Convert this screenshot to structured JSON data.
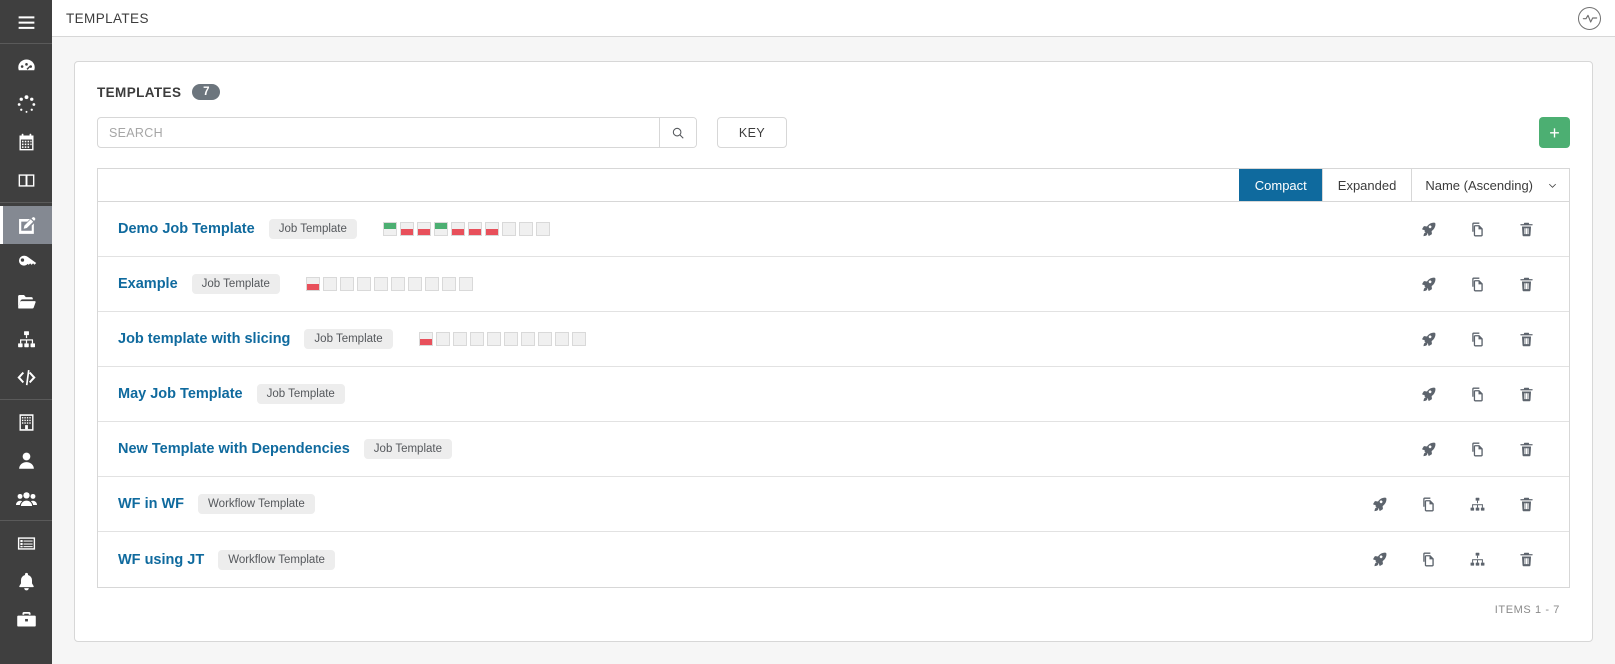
{
  "topbar": {
    "title": "TEMPLATES",
    "logo_icon": "ansible-logo-icon"
  },
  "sidebar": {
    "items": [
      {
        "icon": "hamburger-menu-icon",
        "name": "menu-toggle",
        "active": false
      },
      {
        "icon": "dashboard-gauge-icon",
        "name": "sidebar-item-dashboard",
        "active": false
      },
      {
        "icon": "jobs-spinner-icon",
        "name": "sidebar-item-jobs",
        "active": false
      },
      {
        "icon": "calendar-icon",
        "name": "sidebar-item-schedules",
        "active": false
      },
      {
        "icon": "columns-icon",
        "name": "sidebar-item-activity-stream",
        "active": false
      },
      {
        "icon": "edit-template-icon",
        "name": "sidebar-item-templates",
        "active": true
      },
      {
        "icon": "key-icon",
        "name": "sidebar-item-credentials",
        "active": false
      },
      {
        "icon": "folder-icon",
        "name": "sidebar-item-projects",
        "active": false
      },
      {
        "icon": "sitemap-icon",
        "name": "sidebar-item-inventories",
        "active": false
      },
      {
        "icon": "code-icon",
        "name": "sidebar-item-inventory-scripts",
        "active": false
      },
      {
        "icon": "building-icon",
        "name": "sidebar-item-organizations",
        "active": false
      },
      {
        "icon": "user-icon",
        "name": "sidebar-item-users",
        "active": false
      },
      {
        "icon": "users-group-icon",
        "name": "sidebar-item-teams",
        "active": false
      },
      {
        "icon": "list-icon",
        "name": "sidebar-item-instance-groups",
        "active": false
      },
      {
        "icon": "bell-icon",
        "name": "sidebar-item-notifications",
        "active": false
      },
      {
        "icon": "briefcase-icon",
        "name": "sidebar-item-management-jobs",
        "active": false
      }
    ],
    "separators_after": [
      0,
      4,
      9,
      12
    ]
  },
  "panel": {
    "title": "TEMPLATES",
    "count": "7"
  },
  "search": {
    "placeholder": "SEARCH",
    "value": "",
    "search_icon": "magnifier-icon",
    "key_label": "KEY",
    "add_label": "+"
  },
  "toolbar": {
    "compact_label": "Compact",
    "expanded_label": "Expanded",
    "selected_view": "Compact",
    "sort_label": "Name (Ascending)",
    "chevron_icon": "chevron-down-icon"
  },
  "colors": {
    "accent_blue": "#0f6a9e",
    "add_green": "#4caf72",
    "status_success": "#4caf72",
    "status_failed": "#e8505b",
    "sidebar_bg": "#3f3f3f",
    "badge_gray": "#6c757d"
  },
  "rows": [
    {
      "name": "Demo Job Template",
      "type": "Job Template",
      "is_workflow": false,
      "sparkline": [
        "success",
        "failed",
        "failed",
        "success",
        "failed",
        "failed",
        "failed",
        "empty",
        "empty",
        "empty"
      ],
      "actions": [
        "launch-icon",
        "copy-icon",
        "delete-icon"
      ]
    },
    {
      "name": "Example",
      "type": "Job Template",
      "is_workflow": false,
      "sparkline": [
        "failed",
        "empty",
        "empty",
        "empty",
        "empty",
        "empty",
        "empty",
        "empty",
        "empty",
        "empty"
      ],
      "actions": [
        "launch-icon",
        "copy-icon",
        "delete-icon"
      ]
    },
    {
      "name": "Job template with slicing",
      "type": "Job Template",
      "is_workflow": false,
      "sparkline": [
        "failed",
        "empty",
        "empty",
        "empty",
        "empty",
        "empty",
        "empty",
        "empty",
        "empty",
        "empty"
      ],
      "actions": [
        "launch-icon",
        "copy-icon",
        "delete-icon"
      ]
    },
    {
      "name": "May Job Template",
      "type": "Job Template",
      "is_workflow": false,
      "sparkline": [],
      "actions": [
        "launch-icon",
        "copy-icon",
        "delete-icon"
      ]
    },
    {
      "name": "New Template with Dependencies",
      "type": "Job Template",
      "is_workflow": false,
      "sparkline": [],
      "actions": [
        "launch-icon",
        "copy-icon",
        "delete-icon"
      ]
    },
    {
      "name": "WF in WF",
      "type": "Workflow Template",
      "is_workflow": true,
      "sparkline": [],
      "actions": [
        "launch-icon",
        "copy-icon",
        "workflow-visualizer-icon",
        "delete-icon"
      ]
    },
    {
      "name": "WF using JT",
      "type": "Workflow Template",
      "is_workflow": true,
      "sparkline": [],
      "actions": [
        "launch-icon",
        "copy-icon",
        "workflow-visualizer-icon",
        "delete-icon"
      ]
    }
  ],
  "footer": {
    "items_label": "ITEMS 1 - 7"
  }
}
